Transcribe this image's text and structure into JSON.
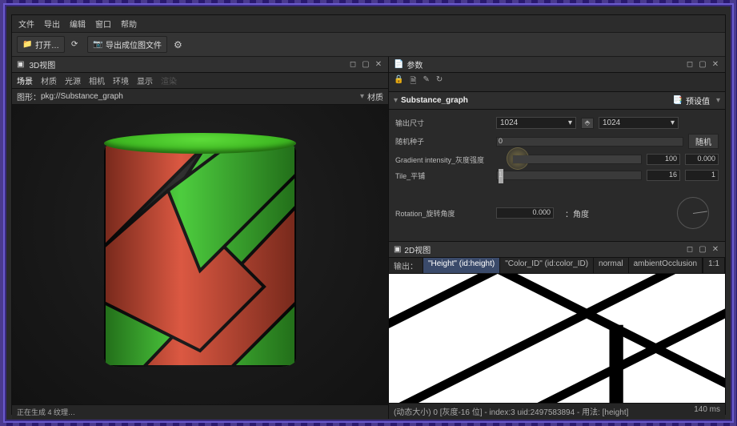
{
  "menu": {
    "file": "文件",
    "export": "导出",
    "edit": "编辑",
    "window": "窗口",
    "help": "帮助"
  },
  "toolbar": {
    "open": "打开…",
    "export_bitmap": "导出成位图文件"
  },
  "view3d": {
    "title": "3D视图",
    "tabs": {
      "scene": "场景",
      "material": "材质",
      "light": "光源",
      "camera": "相机",
      "env": "环境",
      "display": "显示",
      "renderer": "渲染"
    },
    "graph_label": "图形：",
    "graph_path": "pkg://Substance_graph",
    "right_label": "材质"
  },
  "params": {
    "header": "参数",
    "title": "Substance_graph",
    "preset": "预设值",
    "rows": {
      "output_size": "输出尺寸",
      "size_a": "1024",
      "size_b": "1024",
      "seed": "随机种子",
      "seed_val": "0",
      "random_btn": "随机",
      "gradient": "Gradient intensity_灰度强度",
      "grad_val": "100",
      "grad_flt": "0.000",
      "tile": "Tile_平铺",
      "tile_a": "16",
      "tile_b": "1",
      "rotation": "Rotation_旋转角度",
      "rot_val": "0.000",
      "angle_label": "：角度"
    }
  },
  "view2d": {
    "title": "2D视图",
    "out_label": "输出：",
    "tabs": {
      "height": "\"Height\" (id:height)",
      "colorid": "\"Color_ID\" (id:color_ID)",
      "normal": "normal",
      "ao": "ambientOcclusion",
      "one": "1:1"
    }
  },
  "status": {
    "left": "正在生成 4 纹理…",
    "right_main": "(动态大小) 0 [灰度-16 位] - index:3 uid:2497583894 - 用法: [height]",
    "right_ms": "140 ms"
  }
}
